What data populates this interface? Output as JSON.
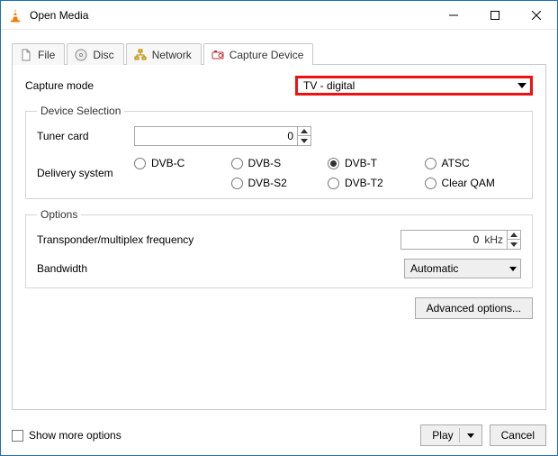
{
  "window": {
    "title": "Open Media"
  },
  "tabs": {
    "file": "File",
    "disc": "Disc",
    "network": "Network",
    "capture": "Capture Device"
  },
  "capture": {
    "mode_label": "Capture mode",
    "mode_value": "TV - digital"
  },
  "device_selection": {
    "legend": "Device Selection",
    "tuner_label": "Tuner card",
    "tuner_value": "0",
    "delivery_label": "Delivery system",
    "options": {
      "dvbc": "DVB-C",
      "dvbs": "DVB-S",
      "dvbt": "DVB-T",
      "atsc": "ATSC",
      "dvbs2": "DVB-S2",
      "dvbt2": "DVB-T2",
      "clearqam": "Clear QAM"
    },
    "selected": "dvbt"
  },
  "options": {
    "legend": "Options",
    "freq_label": "Transponder/multiplex frequency",
    "freq_value": "0",
    "freq_unit": "kHz",
    "bandwidth_label": "Bandwidth",
    "bandwidth_value": "Automatic",
    "advanced_btn": "Advanced options..."
  },
  "footer": {
    "show_more": "Show more options",
    "play": "Play",
    "cancel": "Cancel"
  }
}
